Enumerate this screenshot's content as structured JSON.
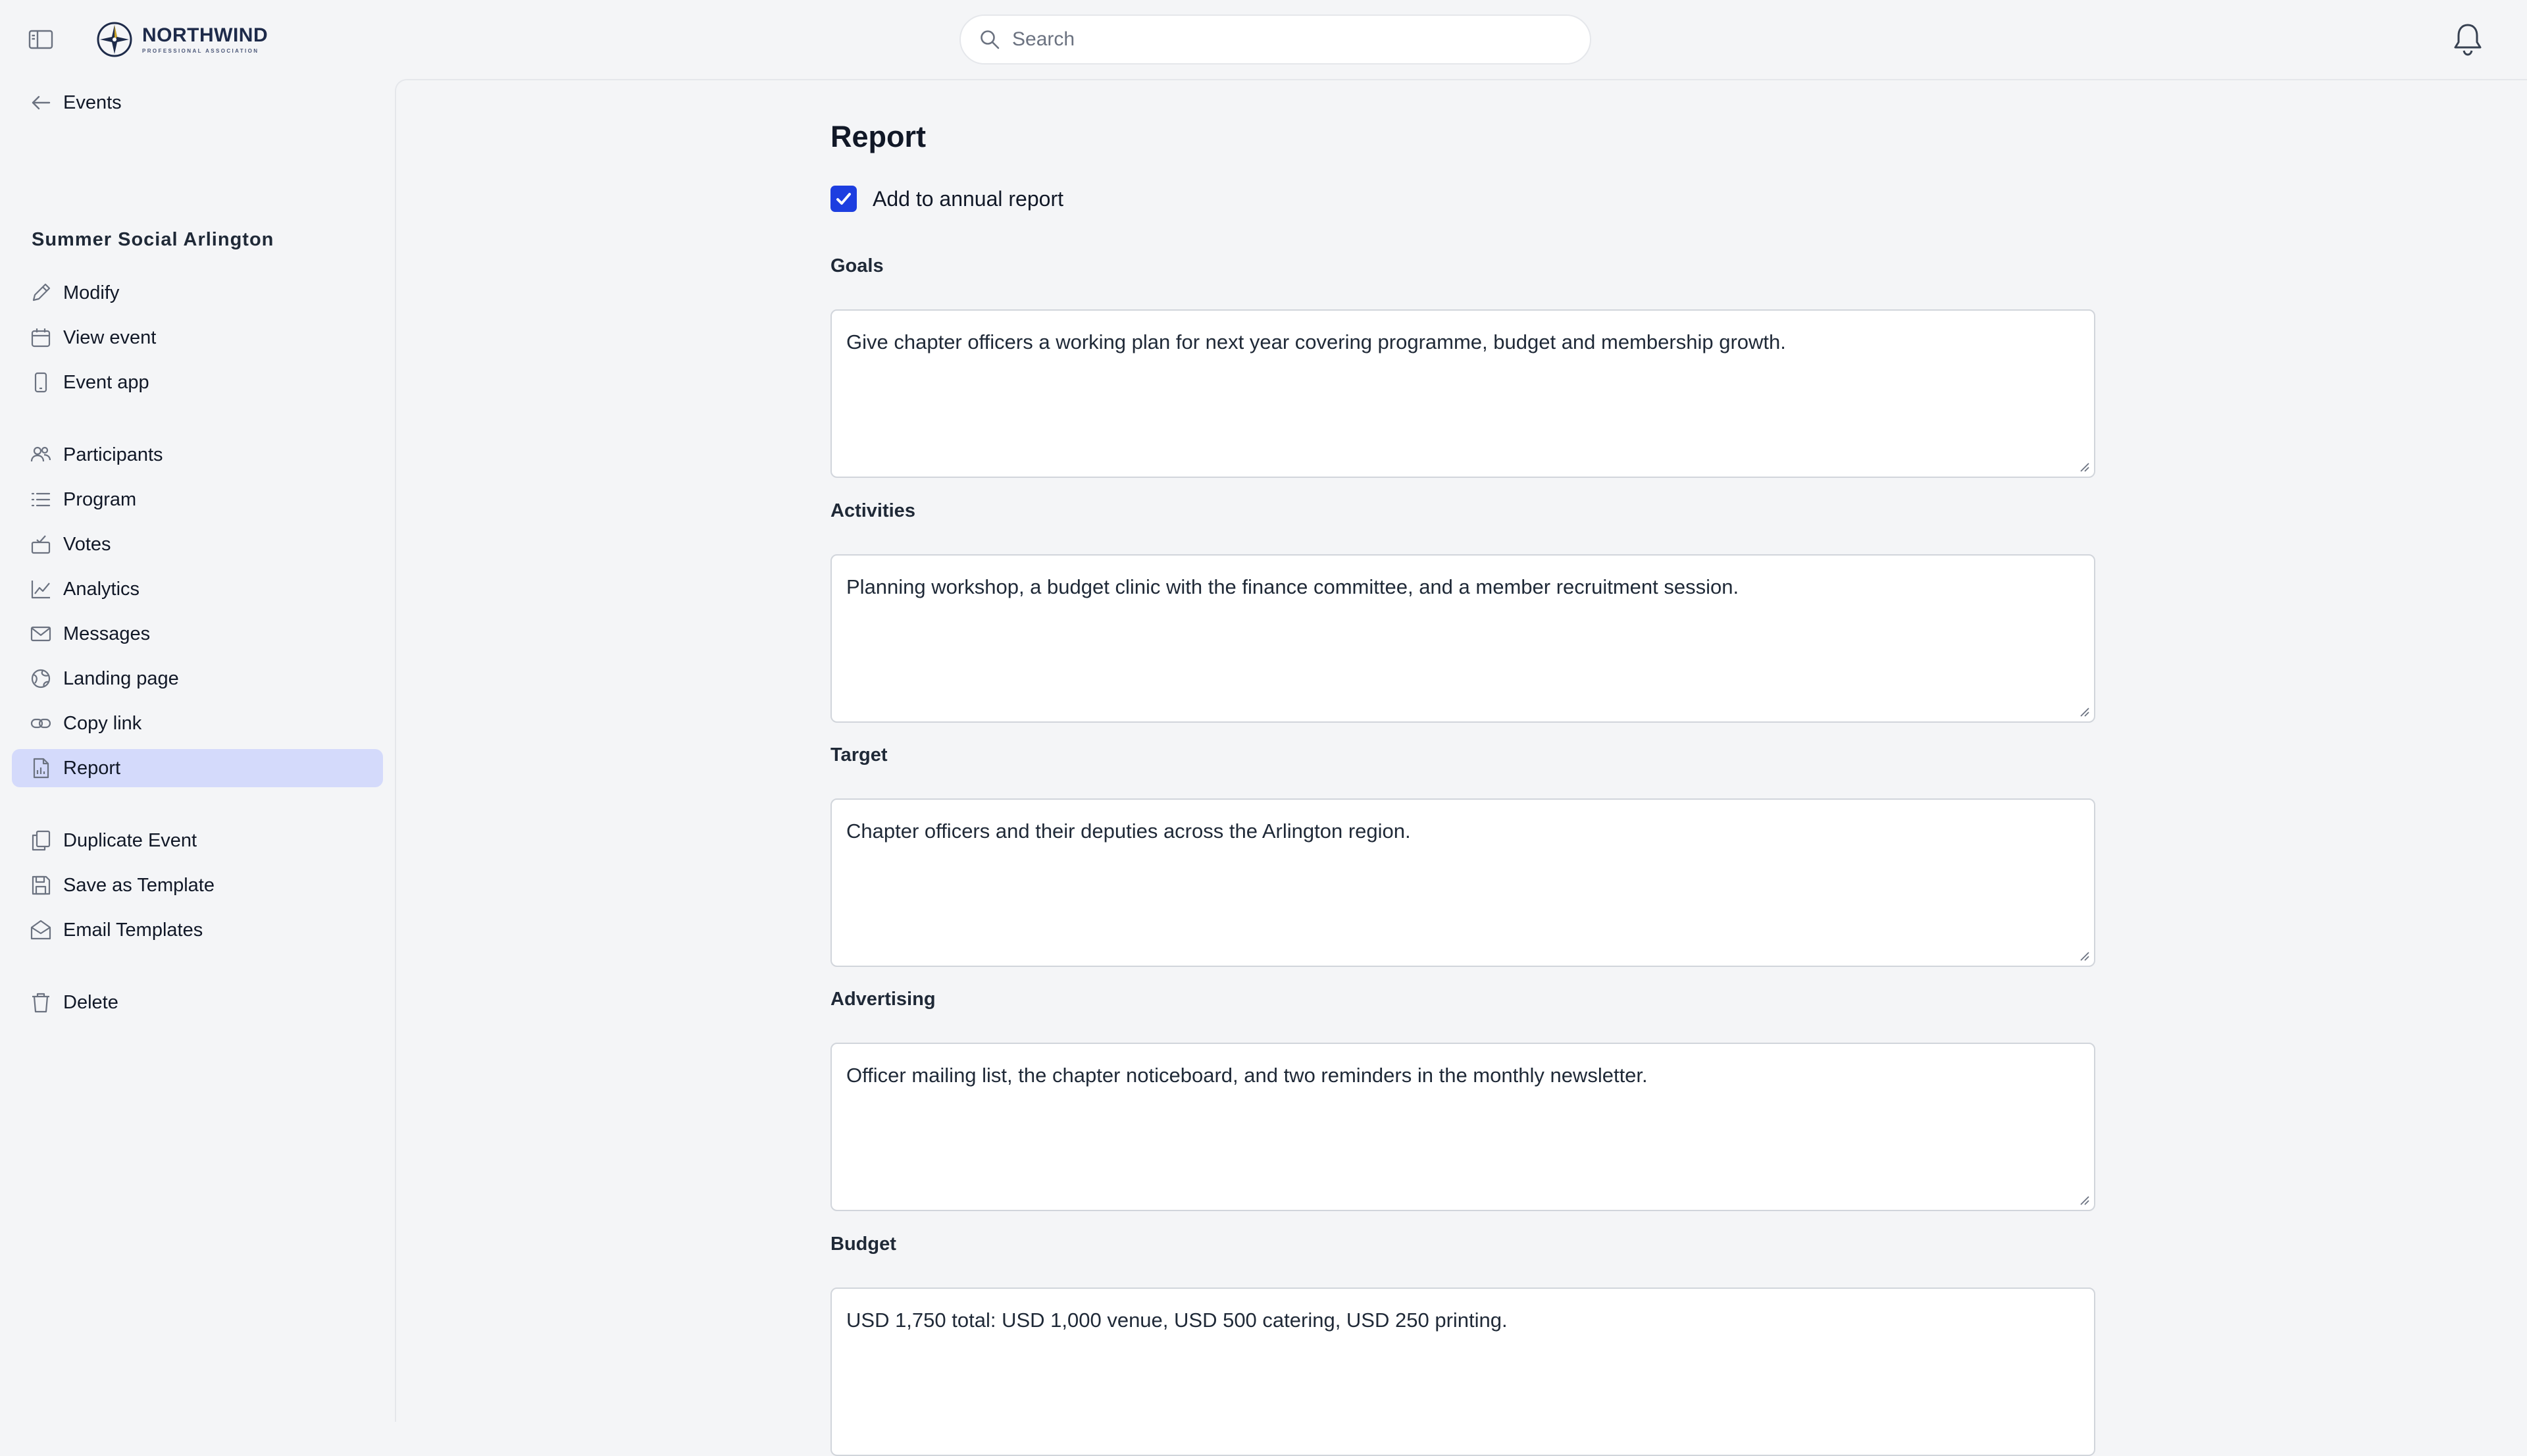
{
  "header": {
    "logo": {
      "name": "NORTHWIND",
      "subtitle": "PROFESSIONAL ASSOCIATION"
    },
    "search": {
      "placeholder": "Search",
      "value": ""
    },
    "icons": {
      "sidebar_toggle": "sidebar-toggle-icon",
      "search": "search-icon",
      "bell": "bell-icon"
    }
  },
  "sidebar": {
    "back": {
      "label": "Events",
      "icon": "arrow-left-icon"
    },
    "event_name": "Summer Social Arlington",
    "group1": [
      {
        "label": "Modify",
        "icon": "pencil-icon"
      },
      {
        "label": "View event",
        "icon": "calendar-icon"
      },
      {
        "label": "Event app",
        "icon": "mobile-icon"
      }
    ],
    "group2": [
      {
        "label": "Participants",
        "icon": "users-icon"
      },
      {
        "label": "Program",
        "icon": "list-icon"
      },
      {
        "label": "Votes",
        "icon": "ballot-icon"
      },
      {
        "label": "Analytics",
        "icon": "chart-icon"
      },
      {
        "label": "Messages",
        "icon": "envelope-icon"
      },
      {
        "label": "Landing page",
        "icon": "globe-icon"
      },
      {
        "label": "Copy link",
        "icon": "link-icon"
      },
      {
        "label": "Report",
        "icon": "report-icon",
        "active": true
      }
    ],
    "group3": [
      {
        "label": "Duplicate Event",
        "icon": "duplicate-icon"
      },
      {
        "label": "Save as Template",
        "icon": "save-icon"
      },
      {
        "label": "Email Templates",
        "icon": "mail-open-icon"
      }
    ],
    "group4": [
      {
        "label": "Delete",
        "icon": "trash-icon"
      }
    ]
  },
  "main": {
    "title": "Report",
    "annual_report": {
      "label": "Add to annual report",
      "checked": true
    },
    "fields": {
      "goals": {
        "label": "Goals",
        "value": "Give chapter officers a working plan for next year covering programme, budget and membership growth."
      },
      "activities": {
        "label": "Activities",
        "value": "Planning workshop, a budget clinic with the finance committee, and a member recruitment session."
      },
      "target": {
        "label": "Target",
        "value": "Chapter officers and their deputies across the Arlington region."
      },
      "advertising": {
        "label": "Advertising",
        "value": "Officer mailing list, the chapter noticeboard, and two reminders in the monthly newsletter."
      },
      "budget": {
        "label": "Budget",
        "value": "USD 1,750 total: USD 1,000 venue, USD 500 catering, USD 250 printing."
      }
    }
  },
  "colors": {
    "accent": "#1d3ee0",
    "active_nav_bg": "#d4dafb",
    "page_bg": "#f4f5f7"
  }
}
